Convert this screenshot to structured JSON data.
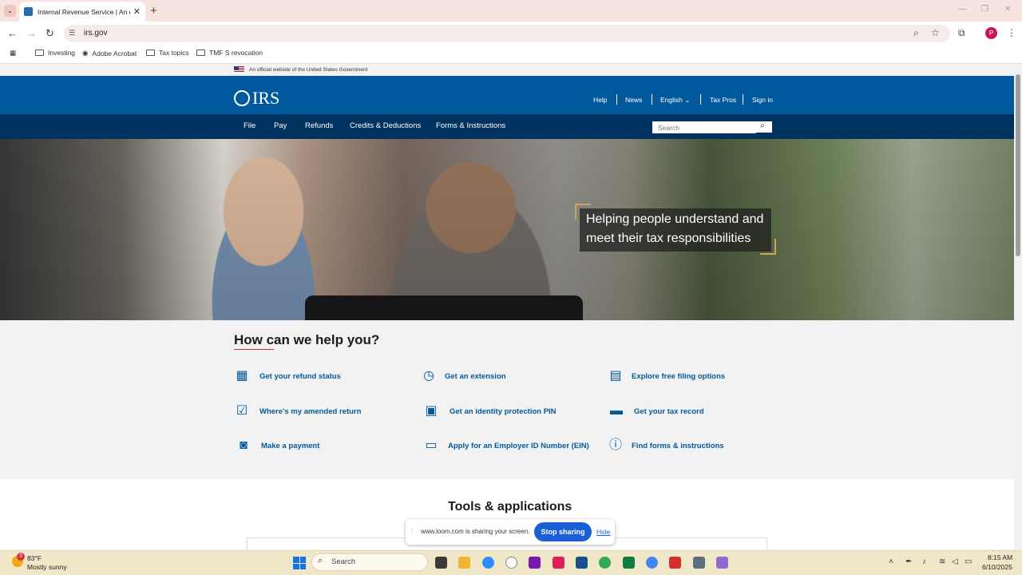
{
  "browser": {
    "tab_title": "Internal Revenue Service | An official website of the United States government",
    "url": "irs.gov",
    "bookmarks": [
      "Investing",
      "Adobe Acrobat",
      "Tax topics",
      "TMF S revocation"
    ],
    "profile_initial": "P"
  },
  "gov_banner": "An official website of the United States Government",
  "header": {
    "logo_text": "IRS",
    "util_links": [
      "Help",
      "News",
      "English",
      "Tax Pros",
      "Sign in"
    ]
  },
  "nav": {
    "items": [
      "File",
      "Pay",
      "Refunds",
      "Credits & Deductions",
      "Forms & Instructions"
    ],
    "search_placeholder": "Search"
  },
  "hero": {
    "tagline_line1": "Helping people understand and",
    "tagline_line2": "meet their tax responsibilities"
  },
  "help": {
    "title": "How can we help you?",
    "links": [
      {
        "label": "Get your refund status",
        "icon": "calendar-icon"
      },
      {
        "label": "Get an extension",
        "icon": "clock-icon"
      },
      {
        "label": "Explore free filing options",
        "icon": "document-icon"
      },
      {
        "label": "Where’s my amended return",
        "icon": "checkbox-icon"
      },
      {
        "label": "Get an identity protection PIN",
        "icon": "id-card-icon"
      },
      {
        "label": "Get your tax record",
        "icon": "archive-box-icon"
      },
      {
        "label": "Make a payment",
        "icon": "money-icon"
      },
      {
        "label": "Apply for an Employer ID Number (EIN)",
        "icon": "laptop-icon"
      },
      {
        "label": "Find forms & instructions",
        "icon": "info-icon"
      }
    ]
  },
  "tools": {
    "title": "Tools & applications"
  },
  "loom": {
    "message": "www.loom.com is sharing your screen.",
    "stop_label": "Stop sharing",
    "hide_label": "Hide"
  },
  "taskbar": {
    "weather_temp": "83°F",
    "weather_desc": "Mostly sunny",
    "weather_badge": "3",
    "search_label": "Search",
    "time": "8:15 AM",
    "date": "6/10/2025"
  },
  "colors": {
    "irs_blue": "#00599c",
    "irs_navy": "#00325f",
    "loom_blue": "#1a5fd6",
    "hero_accent": "#c8a45c"
  }
}
